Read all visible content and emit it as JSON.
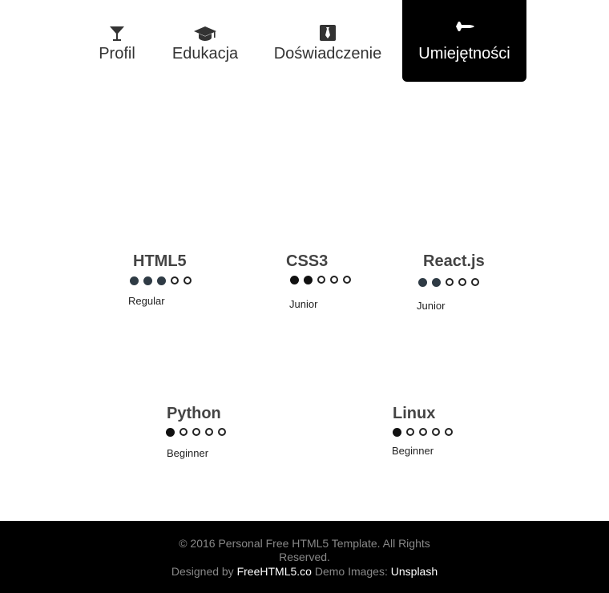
{
  "nav": {
    "tabs": [
      {
        "label": "Profil",
        "icon": "cocktail-glass-icon"
      },
      {
        "label": "Edukacja",
        "icon": "graduation-cap-icon"
      },
      {
        "label": "Doświadczenie",
        "icon": "tie-icon"
      },
      {
        "label": "Umiejętności",
        "icon": "fighter-jet-icon",
        "active": true
      }
    ]
  },
  "skills": [
    {
      "name": "HTML5",
      "level": "Regular",
      "rating": 3,
      "max": 5,
      "dot_color": "#2f3b45"
    },
    {
      "name": "CSS3",
      "level": "Junior",
      "rating": 2,
      "max": 5,
      "dot_color": "#111111"
    },
    {
      "name": "React.js",
      "level": "Junior",
      "rating": 2,
      "max": 5,
      "dot_color": "#2f3b45"
    },
    {
      "name": "Python",
      "level": "Beginner",
      "rating": 1,
      "max": 5,
      "dot_color": "#111111"
    },
    {
      "name": "Linux",
      "level": "Beginner",
      "rating": 1,
      "max": 5,
      "dot_color": "#111111"
    }
  ],
  "footer": {
    "copyright": "© 2016 Personal Free HTML5 Template. All Rights Reserved.",
    "designed_by_prefix": "Designed by",
    "designed_by_link": "FreeHTML5.co",
    "demo_images_prefix": "Demo Images:",
    "demo_images_link": "Unsplash"
  }
}
